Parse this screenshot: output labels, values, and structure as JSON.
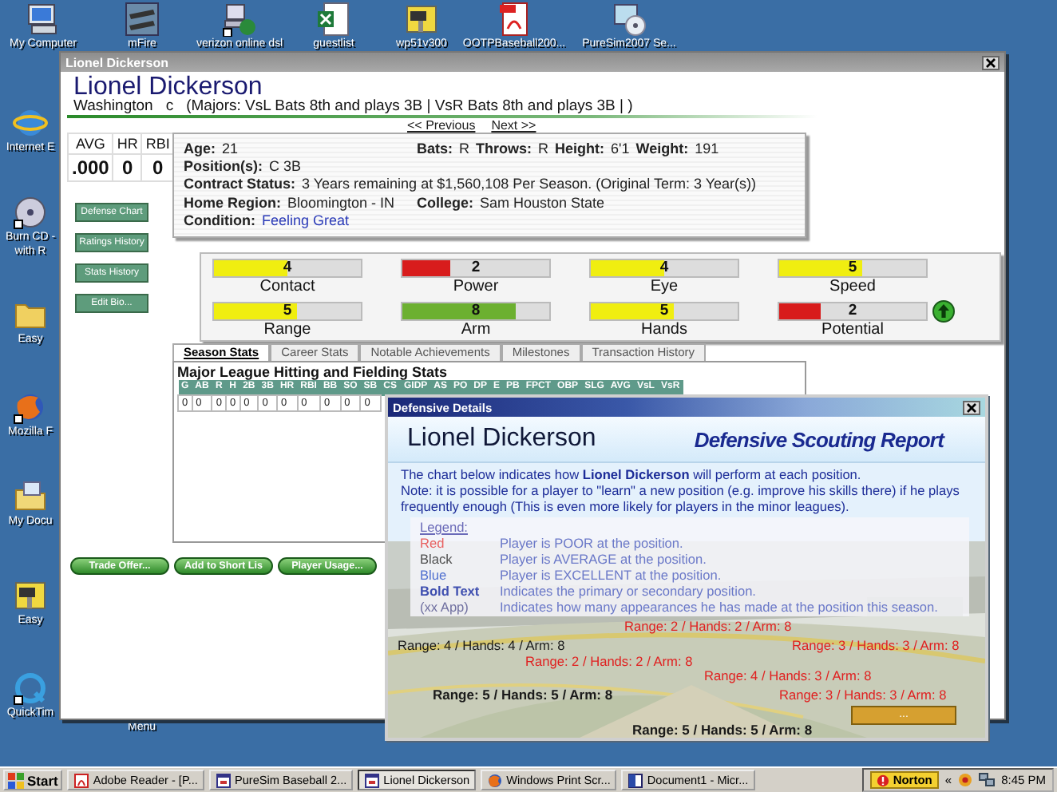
{
  "desktop": {
    "top_icons": [
      {
        "label": "My Computer",
        "kind": "computer"
      },
      {
        "label": "mFire",
        "kind": "thumbnail"
      },
      {
        "label": "verizon online dsl",
        "kind": "network"
      },
      {
        "label": "guestlist",
        "kind": "spreadsheet"
      },
      {
        "label": "wp51v300",
        "kind": "zip"
      },
      {
        "label": "OOTPBaseball200...",
        "kind": "pdf"
      },
      {
        "label": "PureSim2007 Se...",
        "kind": "cd"
      }
    ],
    "left_icons": [
      {
        "lines": [
          "Internet E"
        ],
        "kind": "globe"
      },
      {
        "lines": [
          "Burn CD -",
          "with R"
        ],
        "kind": "music"
      },
      {
        "lines": [
          "Easy"
        ],
        "kind": "folder"
      },
      {
        "lines": [
          "Mozilla F"
        ],
        "kind": "fox"
      },
      {
        "lines": [
          "My Docu"
        ],
        "kind": "mailfolder"
      },
      {
        "lines": [
          "Easy"
        ],
        "kind": "zip"
      },
      {
        "lines": [
          "QuickTim"
        ],
        "kind": "quicktime"
      }
    ],
    "under_window_label": "Menu"
  },
  "player_window": {
    "title": "Lionel Dickerson",
    "name": "Lionel Dickerson",
    "team": "Washington",
    "position": "c",
    "assignment": "(Majors: VsL Bats 8th and plays 3B | VsR Bats 8th and plays 3B | )",
    "nav": [
      "<< Previous",
      "Next >>"
    ],
    "summary": {
      "columns": [
        "AVG",
        "HR",
        "RBI"
      ],
      "values": [
        ".000",
        "0",
        "0"
      ]
    },
    "side_buttons": [
      "Defense Chart",
      "Ratings History",
      "Stats History",
      "Edit Bio..."
    ],
    "info_rows": [
      [
        [
          {
            "label": "Age:",
            "value": "21"
          }
        ],
        [
          {
            "label": "Bats:",
            "value": "R"
          },
          {
            "label": "Throws:",
            "value": "R"
          },
          {
            "label": "Height:",
            "value": "6'1"
          },
          {
            "label": "Weight:",
            "value": "191"
          }
        ]
      ],
      [
        [
          {
            "label": "Position(s):",
            "value": "C  3B"
          }
        ]
      ],
      [
        [
          {
            "label": "Contract Status:",
            "value": "3 Years remaining at $1,560,108 Per Season. (Original Term: 3 Year(s))"
          }
        ]
      ],
      [
        [
          {
            "label": "Home Region:",
            "value": "Bloomington -  IN"
          }
        ],
        [
          {
            "label": "College:",
            "value": "Sam Houston State"
          }
        ]
      ]
    ],
    "condition": {
      "label": "Condition:",
      "value": "Feeling Great"
    },
    "ratings": [
      {
        "name": "Contact",
        "value": "4",
        "level": 0.5,
        "color": "#f0ee10",
        "rising": false
      },
      {
        "name": "Power",
        "value": "2",
        "level": 0.33,
        "color": "#d81c1c",
        "rising": false
      },
      {
        "name": "Eye",
        "value": "4",
        "level": 0.5,
        "color": "#f0ee10",
        "rising": false
      },
      {
        "name": "Speed",
        "value": "5",
        "level": 0.57,
        "color": "#f0ee10",
        "rising": false
      },
      {
        "name": "Range",
        "value": "5",
        "level": 0.57,
        "color": "#f0ee10",
        "rising": false
      },
      {
        "name": "Arm",
        "value": "8",
        "level": 0.77,
        "color": "#6cb030",
        "rising": false
      },
      {
        "name": "Hands",
        "value": "5",
        "level": 0.57,
        "color": "#f0ee10",
        "rising": false
      },
      {
        "name": "Potential",
        "value": "2",
        "level": 0.28,
        "color": "#d81c1c",
        "rising": true
      }
    ],
    "tabs": [
      {
        "label": "Season Stats",
        "selected": true
      },
      {
        "label": "Career Stats",
        "selected": false
      },
      {
        "label": "Notable Achievements",
        "selected": false
      },
      {
        "label": "Milestones",
        "selected": false
      },
      {
        "label": "Transaction History",
        "selected": false
      }
    ],
    "stats": {
      "title": "Major League Hitting and Fielding Stats",
      "columns": [
        "G",
        "AB",
        "R",
        "H",
        "2B",
        "3B",
        "HR",
        "RBI",
        "BB",
        "SO",
        "SB",
        "CS",
        "GIDP",
        "AS",
        "PO",
        "DP",
        "E",
        "PB",
        "FPCT",
        "OBP",
        "SLG",
        "AVG",
        "VsL",
        "VsR"
      ],
      "rows": [
        [
          "0",
          "0",
          "0",
          "0",
          "0",
          "0",
          "0",
          "0",
          "0",
          "0",
          "0"
        ]
      ]
    },
    "buttons": [
      "Trade Offer...",
      "Add to Short Lis",
      "Player Usage..."
    ]
  },
  "defense_window": {
    "title": "Defensive Details",
    "name": "Lionel Dickerson",
    "report_title": "Defensive Scouting Report",
    "intro": "The chart below indicates how **Lionel Dickerson** will perform at each position.",
    "note": "Note: it is possible for a player to \"learn\" a new position (e.g. improve his skills there) if he plays frequently enough (This is even more likely for players in the minor leagues).",
    "legend": {
      "title": "Legend:",
      "items": [
        {
          "term": "Red",
          "description": "Player is POOR at the position.",
          "kind": "poor"
        },
        {
          "term": "Black",
          "description": "Player is AVERAGE at the position.",
          "kind": "average"
        },
        {
          "term": "Blue",
          "description": "Player is EXCELLENT at the position.",
          "kind": "excellent"
        },
        {
          "term": "Bold Text",
          "description": "Indicates the primary or secondary position.",
          "kind": "bold"
        },
        {
          "term": "(xx App)",
          "description": "Indicates how many appearances he has made at the position this season.",
          "kind": "appearances"
        }
      ]
    },
    "positions": [
      {
        "text": "Range: 2 / Hands: 2 / Arm: 8",
        "color": "#e02020",
        "primary": false
      },
      {
        "text": "Range: 4 / Hands: 4 / Arm: 8",
        "color": "#1a1a1a",
        "primary": false
      },
      {
        "text": "Range: 3 / Hands: 3 / Arm: 8",
        "color": "#e02020",
        "primary": false
      },
      {
        "text": "Range: 2 / Hands: 2 / Arm: 8",
        "color": "#e02020",
        "primary": false
      },
      {
        "text": "Range: 4 / Hands: 3 / Arm: 8",
        "color": "#e02020",
        "primary": false
      },
      {
        "text": "Range: 5 / Hands: 5 / Arm: 8",
        "color": "#1a1a1a",
        "primary": true
      },
      {
        "text": "Range: 3 / Hands: 3 / Arm: 8",
        "color": "#e02020",
        "primary": false
      },
      {
        "text": "Range: 5 / Hands: 5 / Arm: 8",
        "color": "#1a1a1a",
        "primary": true
      }
    ],
    "button": "..."
  },
  "taskbar": {
    "start": "Start",
    "tasks": [
      {
        "label": "Adobe Reader - [P...",
        "selected": false,
        "kind": "pdf"
      },
      {
        "label": "PureSim Baseball 2...",
        "selected": false,
        "kind": "app"
      },
      {
        "label": "Lionel Dickerson",
        "selected": true,
        "kind": "app"
      },
      {
        "label": "Windows Print Scr...",
        "selected": false,
        "kind": "browser"
      },
      {
        "label": "Document1 - Micr...",
        "selected": false,
        "kind": "doc"
      }
    ],
    "tray": {
      "norton": "Norton",
      "chevron": "«",
      "time": "8:45 PM"
    }
  }
}
